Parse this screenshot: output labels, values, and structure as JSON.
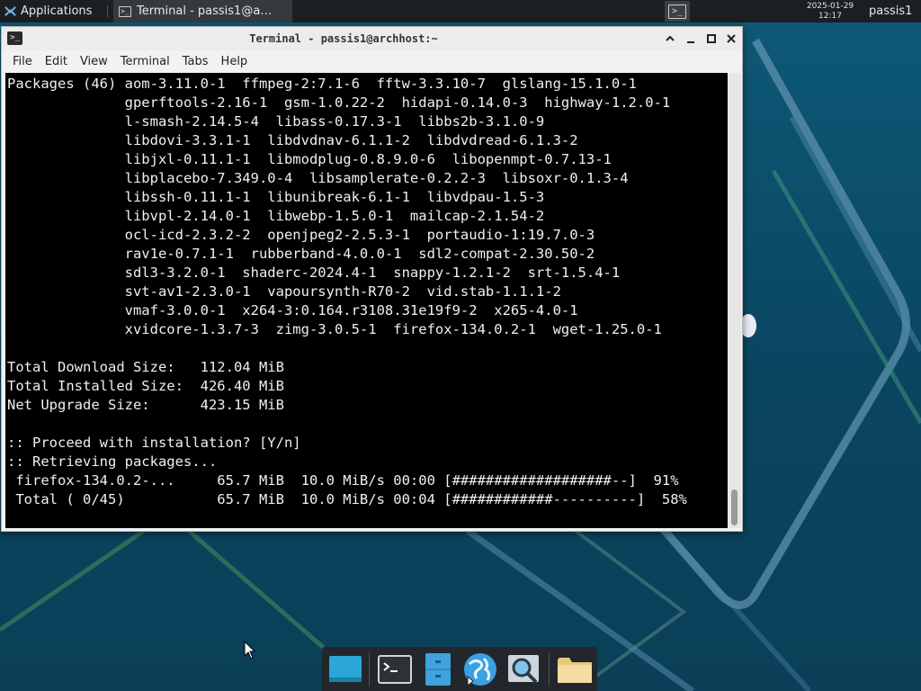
{
  "top_panel": {
    "applications_label": "Applications",
    "task_label": "Terminal - passis1@a…",
    "clock_date": "2025-01-29",
    "clock_time": "12:17",
    "user": "passis1"
  },
  "window": {
    "title": "Terminal - passis1@archhost:~",
    "menu": [
      "File",
      "Edit",
      "View",
      "Terminal",
      "Tabs",
      "Help"
    ]
  },
  "terminal": {
    "lines": [
      "Packages (46) aom-3.11.0-1  ffmpeg-2:7.1-6  fftw-3.3.10-7  glslang-15.1.0-1",
      "              gperftools-2.16-1  gsm-1.0.22-2  hidapi-0.14.0-3  highway-1.2.0-1",
      "              l-smash-2.14.5-4  libass-0.17.3-1  libbs2b-3.1.0-9",
      "              libdovi-3.3.1-1  libdvdnav-6.1.1-2  libdvdread-6.1.3-2",
      "              libjxl-0.11.1-1  libmodplug-0.8.9.0-6  libopenmpt-0.7.13-1",
      "              libplacebo-7.349.0-4  libsamplerate-0.2.2-3  libsoxr-0.1.3-4",
      "              libssh-0.11.1-1  libunibreak-6.1-1  libvdpau-1.5-3",
      "              libvpl-2.14.0-1  libwebp-1.5.0-1  mailcap-2.1.54-2",
      "              ocl-icd-2.3.2-2  openjpeg2-2.5.3-1  portaudio-1:19.7.0-3",
      "              rav1e-0.7.1-1  rubberband-4.0.0-1  sdl2-compat-2.30.50-2",
      "              sdl3-3.2.0-1  shaderc-2024.4-1  snappy-1.2.1-2  srt-1.5.4-1",
      "              svt-av1-2.3.0-1  vapoursynth-R70-2  vid.stab-1.1.1-2",
      "              vmaf-3.0.0-1  x264-3:0.164.r3108.31e19f9-2  x265-4.0-1",
      "              xvidcore-1.3.7-3  zimg-3.0.5-1  firefox-134.0.2-1  wget-1.25.0-1",
      "",
      "Total Download Size:   112.04 MiB",
      "Total Installed Size:  426.40 MiB",
      "Net Upgrade Size:      423.15 MiB",
      "",
      ":: Proceed with installation? [Y/n]",
      ":: Retrieving packages...",
      " firefox-134.0.2-...     65.7 MiB  10.0 MiB/s 00:00 [###################--]  91%",
      " Total ( 0/45)           65.7 MiB  10.0 MiB/s 00:04 [############----------]  58%"
    ]
  },
  "dock": {
    "items": [
      "desktop-icon",
      "terminal-icon",
      "file-manager-icon",
      "web-browser-icon",
      "search-icon",
      "folder-icon"
    ]
  },
  "colors": {
    "panel": "#1c1f22",
    "desktop": "#0d5a78",
    "terminal_bg": "#000000",
    "terminal_fg": "#f0f0f0"
  }
}
